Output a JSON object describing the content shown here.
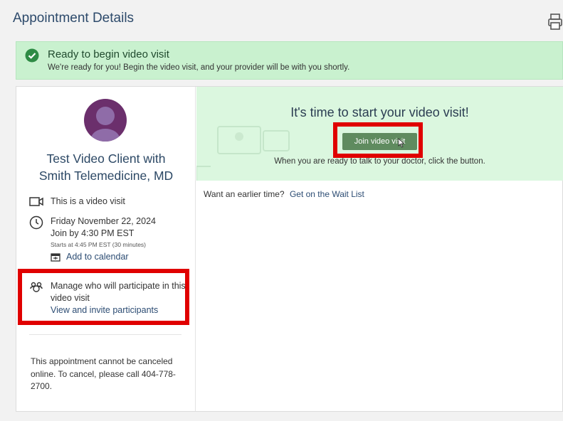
{
  "header": {
    "title": "Appointment Details",
    "print_icon": "printer-icon"
  },
  "banner": {
    "icon": "check-circle-icon",
    "title": "Ready to begin video visit",
    "subtitle": "We're ready for you! Begin the video visit, and your provider will be with you shortly."
  },
  "appointment": {
    "client_line1": "Test Video Client with",
    "client_line2": "Smith Telemedicine, MD",
    "visit_type": "This is a video visit",
    "date": "Friday November 22, 2024",
    "join_by": "Join by 4:30 PM EST",
    "starts_at": "Starts at 4:45 PM EST (30 minutes)",
    "add_to_calendar": "Add to calendar",
    "manage_participants": "Manage who will participate in this video visit",
    "invite_link": "View and invite participants",
    "cancel_note": "This appointment cannot be canceled online. To cancel, please call 404-778-2700."
  },
  "video_visit": {
    "title": "It's time to start your video visit!",
    "join_button": "Join video visit",
    "hint": "When you are ready to talk to your doctor, click the button."
  },
  "waitlist": {
    "prompt": "Want an earlier time?",
    "link": "Get on the Wait List"
  },
  "colors": {
    "banner_bg": "#c9f1cf",
    "hero_bg": "#dbf7df",
    "join_button": "#5f8b5f",
    "highlight": "#e00000",
    "avatar": "#6b2f6c"
  }
}
